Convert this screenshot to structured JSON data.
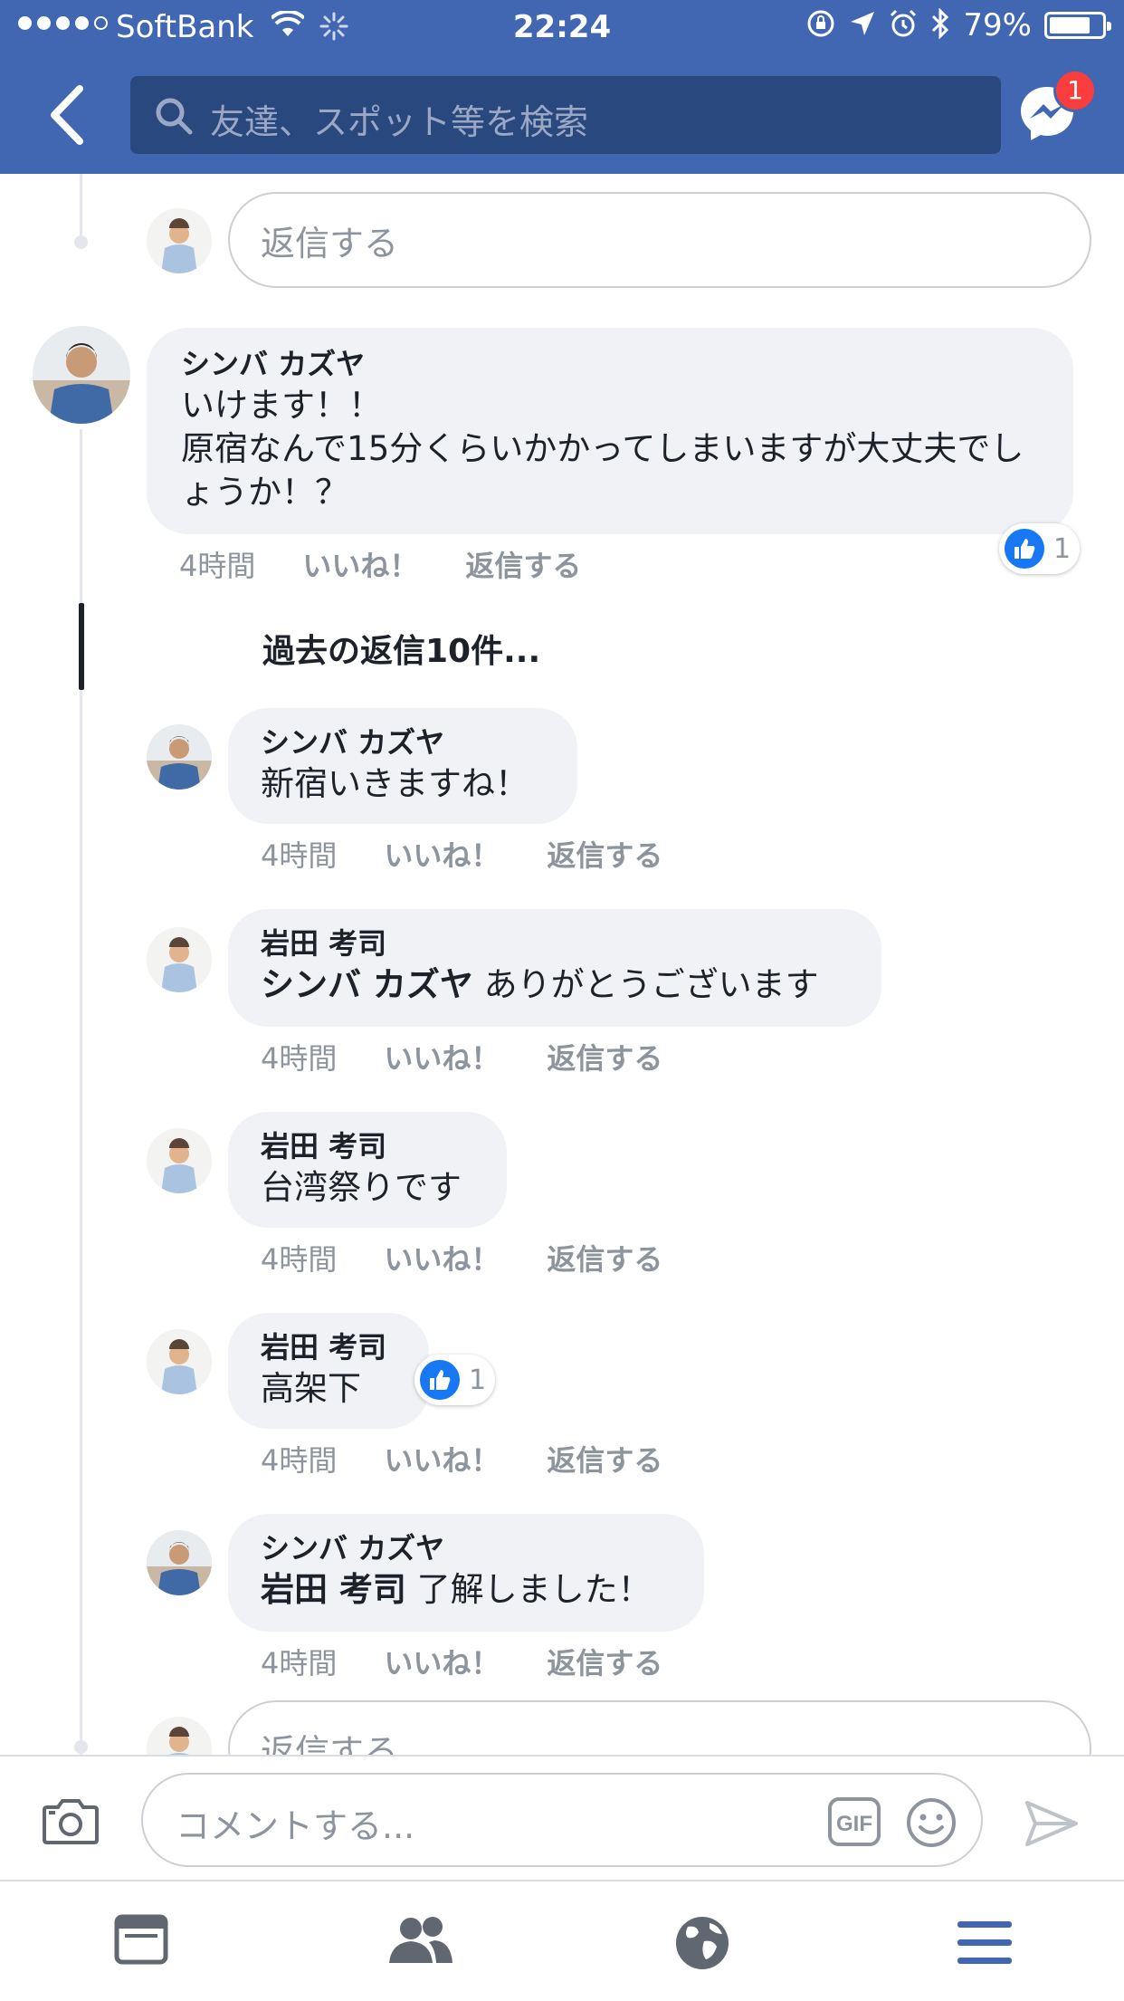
{
  "status_bar": {
    "carrier": "SoftBank",
    "time": "22:24",
    "battery_percent": "79%",
    "battery_level": 0.79
  },
  "nav": {
    "search_placeholder": "友達、スポット等を検索",
    "messenger_badge": "1"
  },
  "top_reply_placeholder": "返信する",
  "comment": {
    "author": "シンバ カズヤ",
    "text": "いけます！！\n原宿なんで15分くらいかかってしまいますが大丈夫でしょうか！？",
    "time": "4時間",
    "like_label": "いいね！",
    "reply_label": "返信する",
    "reaction_count": "1"
  },
  "previous_replies": "過去の返信10件...",
  "replies": [
    {
      "author": "シンバ カズヤ",
      "mention": "",
      "text": "新宿いきますね！",
      "time": "4時間",
      "like_label": "いいね！",
      "reply_label": "返信する"
    },
    {
      "author": "岩田 考司",
      "mention": "シンバ カズヤ",
      "text": " ありがとうございます",
      "time": "4時間",
      "like_label": "いいね！",
      "reply_label": "返信する"
    },
    {
      "author": "岩田 考司",
      "mention": "",
      "text": "台湾祭りです",
      "time": "4時間",
      "like_label": "いいね！",
      "reply_label": "返信する"
    },
    {
      "author": "岩田 考司",
      "mention": "",
      "text": "高架下",
      "time": "4時間",
      "like_label": "いいね！",
      "reply_label": "返信する",
      "reaction_count": "1"
    },
    {
      "author": "シンバ カズヤ",
      "mention": "岩田 考司",
      "text": " 了解しました！",
      "time": "4時間",
      "like_label": "いいね！",
      "reply_label": "返信する"
    }
  ],
  "bottom_reply_placeholder": "返信する",
  "composer": {
    "placeholder": "コメントする...",
    "gif_label": "GIF"
  },
  "colors": {
    "brand": "#4267b2",
    "like_blue": "#1877f2",
    "bubble": "#f0f2f5",
    "badge": "#fa3e3e"
  }
}
